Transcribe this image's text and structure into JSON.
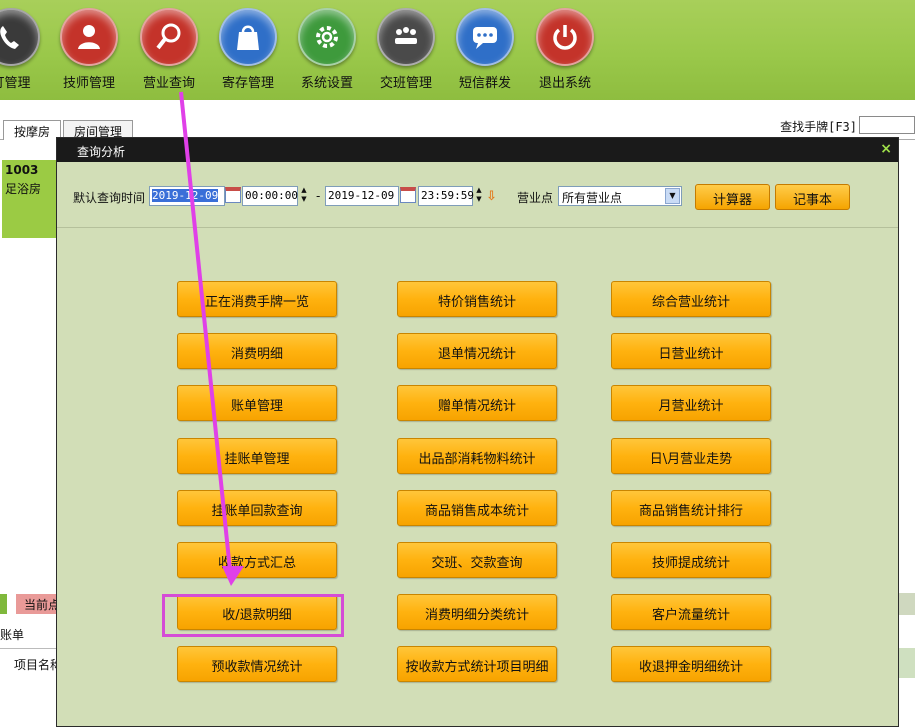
{
  "toolbar": {
    "items": [
      {
        "label": "订管理",
        "icon": "phone-icon",
        "color": "#3a3a3a"
      },
      {
        "label": "技师管理",
        "icon": "person-icon",
        "color": "#c4332a"
      },
      {
        "label": "营业查询",
        "icon": "magnifier-icon",
        "color": "#c4332a"
      },
      {
        "label": "寄存管理",
        "icon": "bag-icon",
        "color": "#2f6fc8"
      },
      {
        "label": "系统设置",
        "icon": "gear-icon",
        "color": "#3e9a3c"
      },
      {
        "label": "交班管理",
        "icon": "meeting-icon",
        "color": "#4a4a4a"
      },
      {
        "label": "短信群发",
        "icon": "chat-icon",
        "color": "#2f6fc8"
      },
      {
        "label": "退出系统",
        "icon": "power-icon",
        "color": "#c4332a"
      }
    ]
  },
  "tabs": [
    {
      "label": "按摩房"
    },
    {
      "label": "房间管理"
    }
  ],
  "search": {
    "label": "查找手牌[F3]",
    "value": ""
  },
  "room": {
    "number": "1003",
    "name": "足浴房"
  },
  "left_bottom": {
    "badge": "当前点",
    "tab": "账单",
    "column": "项目名称"
  },
  "dialog": {
    "title": "查询分析",
    "close": "×",
    "filter": {
      "time_label": "默认查询时间",
      "start_date_sel": "2019-12-09",
      "start_time": "00:00:00",
      "dash": "-",
      "end_date": "2019-12-09",
      "end_time": "23:59:59",
      "outlet_label": "营业点",
      "outlet_value": "所有营业点",
      "calculator": "计算器",
      "notepad": "记事本"
    },
    "grid": [
      [
        "正在消费手牌一览",
        "特价销售统计",
        "综合营业统计"
      ],
      [
        "消费明细",
        "退单情况统计",
        "日营业统计"
      ],
      [
        "账单管理",
        "赠单情况统计",
        "月营业统计"
      ],
      [
        "挂账单管理",
        "出品部消耗物料统计",
        "日\\月营业走势"
      ],
      [
        "挂账单回款查询",
        "商品销售成本统计",
        "商品销售统计排行"
      ],
      [
        "收款方式汇总",
        "交班、交款查询",
        "技师提成统计"
      ],
      [
        "收/退款明细",
        "消费明细分类统计",
        "客户流量统计"
      ],
      [
        "预收款情况统计",
        "按收款方式统计项目明细",
        "收退押金明细统计"
      ]
    ]
  },
  "annotation": {
    "arrow_color": "#e040e8",
    "box_color": "#d54cd6"
  }
}
